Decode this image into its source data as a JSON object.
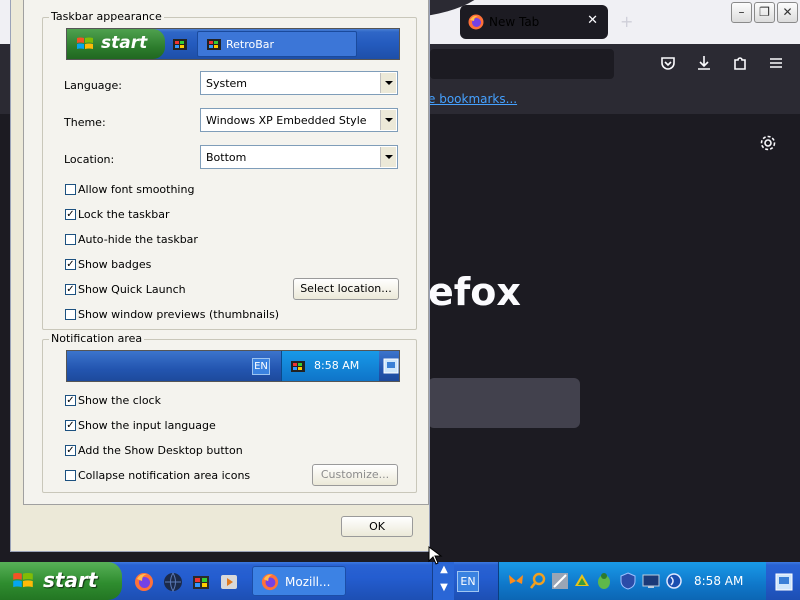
{
  "firefox": {
    "tab_title": "New Tab",
    "tab_close": "✕",
    "new_tab": "+",
    "bookmarks_link": "e bookmarks...",
    "brand_partial": "efox",
    "win_minimize": "–",
    "win_restore": "❐",
    "win_close": "✕"
  },
  "dialog": {
    "taskbar_appearance": {
      "title": "Taskbar appearance",
      "preview": {
        "start_label": "start",
        "window_title": "RetroBar"
      },
      "language_label": "Language:",
      "language_value": "System",
      "theme_label": "Theme:",
      "theme_value": "Windows XP Embedded Style",
      "location_label": "Location:",
      "location_value": "Bottom",
      "options": [
        {
          "label": "Allow font smoothing",
          "checked": false
        },
        {
          "label": "Lock the taskbar",
          "checked": true
        },
        {
          "label": "Auto-hide the taskbar",
          "checked": false
        },
        {
          "label": "Show badges",
          "checked": true
        },
        {
          "label": "Show Quick Launch",
          "checked": true
        },
        {
          "label": "Show window previews (thumbnails)",
          "checked": false
        }
      ],
      "select_location_button": "Select location..."
    },
    "notification_area": {
      "title": "Notification area",
      "preview": {
        "lang": "EN",
        "time": "8:58 AM"
      },
      "options": [
        {
          "label": "Show the clock",
          "checked": true
        },
        {
          "label": "Show the input language",
          "checked": true
        },
        {
          "label": "Add the Show Desktop button",
          "checked": true
        },
        {
          "label": "Collapse notification area icons",
          "checked": false
        }
      ],
      "customize_button": "Customize..."
    },
    "ok_button": "OK"
  },
  "taskbar": {
    "start_label": "start",
    "task_label": "Mozill...",
    "lang": "EN",
    "clock": "8:58 AM",
    "up": "▲",
    "down": "▼"
  },
  "colors": {
    "xp_blue": "#245dd0",
    "start_green": "#2f8d2f",
    "tray_blue": "#0f77c9",
    "firefox_dark": "#1c1b22"
  }
}
